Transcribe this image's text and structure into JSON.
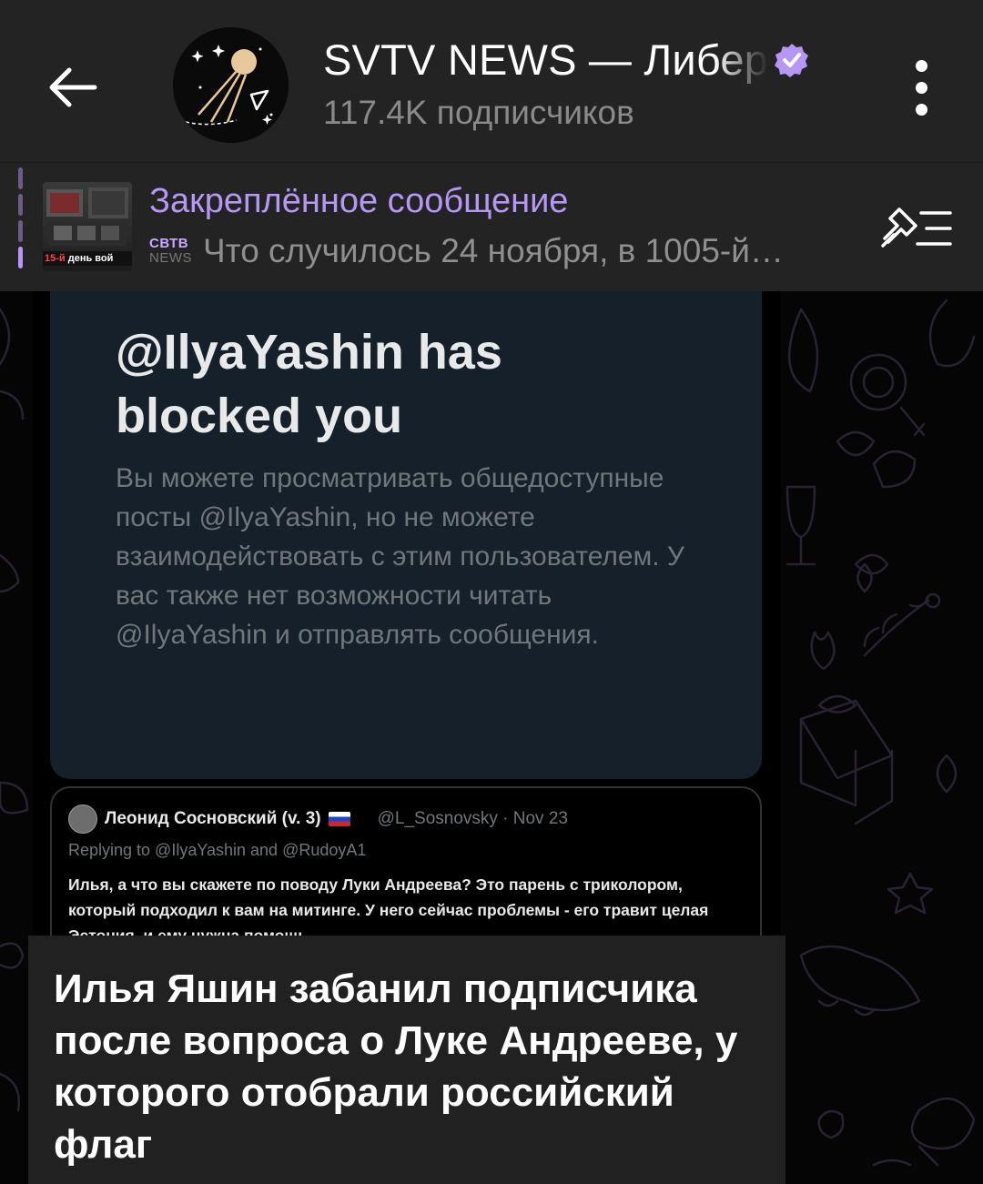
{
  "header": {
    "title": "SVTV NEWS — Либер",
    "subscribers": "117.4K подписчиков",
    "accent": "#b697f5"
  },
  "pinned": {
    "title": "Закреплённое сообщение",
    "logo_top": "СВТВ",
    "logo_bottom": "NEWS",
    "text": "Что случилось 24 ноября, в 1005-й…",
    "thumb_prefix": "15-й",
    "thumb_label": " день вой"
  },
  "photo": {
    "blocked_heading": "@IlyaYashin has blocked you",
    "blocked_body": "Вы можете просматривать общедоступные посты @IlyaYashin, но не можете взаимодействовать с этим пользователем. У вас также нет возможности читать @IlyaYashin и отправлять сообщения.",
    "tweet": {
      "author": "Леонид Сосновский (v. 3)",
      "meta": "@L_Sosnovsky · Nov 23",
      "reply": "Replying to @IlyaYashin and @RudoyA1",
      "text": "Илья, а что вы скажете по поводу Луки Андреева? Это парень с триколором, который подходил к вам на митинге. У него сейчас проблемы - его травит целая Эстония, и ему нужна помощь."
    }
  },
  "caption": {
    "text": "Илья Яшин забанил подписчика после вопроса о Луке Андрееве, у которого отобрали российский флаг"
  },
  "icons": [
    "back-arrow-icon",
    "verified-badge-icon",
    "more-vert-icon",
    "unpin-list-icon"
  ]
}
